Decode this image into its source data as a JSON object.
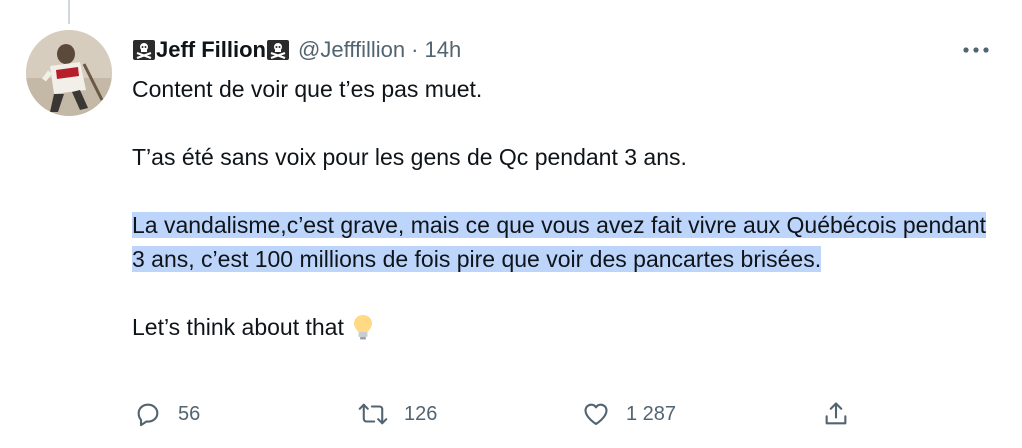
{
  "tweet": {
    "display_name": "Jeff Fillion",
    "handle": "@Jefffillion",
    "separator": "·",
    "time": "14h",
    "paragraphs": [
      "Content de voir que t’es pas muet.",
      "T’as été sans voix pour les gens de Qc pendant 3 ans.",
      "La vandalisme,c’est grave, mais ce que vous avez fait vivre aux Québécois pendant 3 ans, c’est 100 millions de fois pire que voir des pancartes brisées.",
      "Let’s think about that"
    ],
    "emoji": "light-bulb",
    "selection_color": "#bdd5fb",
    "flag_icon": "pirate-flag-icon"
  },
  "actions": {
    "reply_count": "56",
    "retweet_count": "126",
    "like_count": "1 287",
    "share_icon": "share-icon"
  },
  "colors": {
    "text": "#0f1419",
    "secondary": "#536471"
  }
}
